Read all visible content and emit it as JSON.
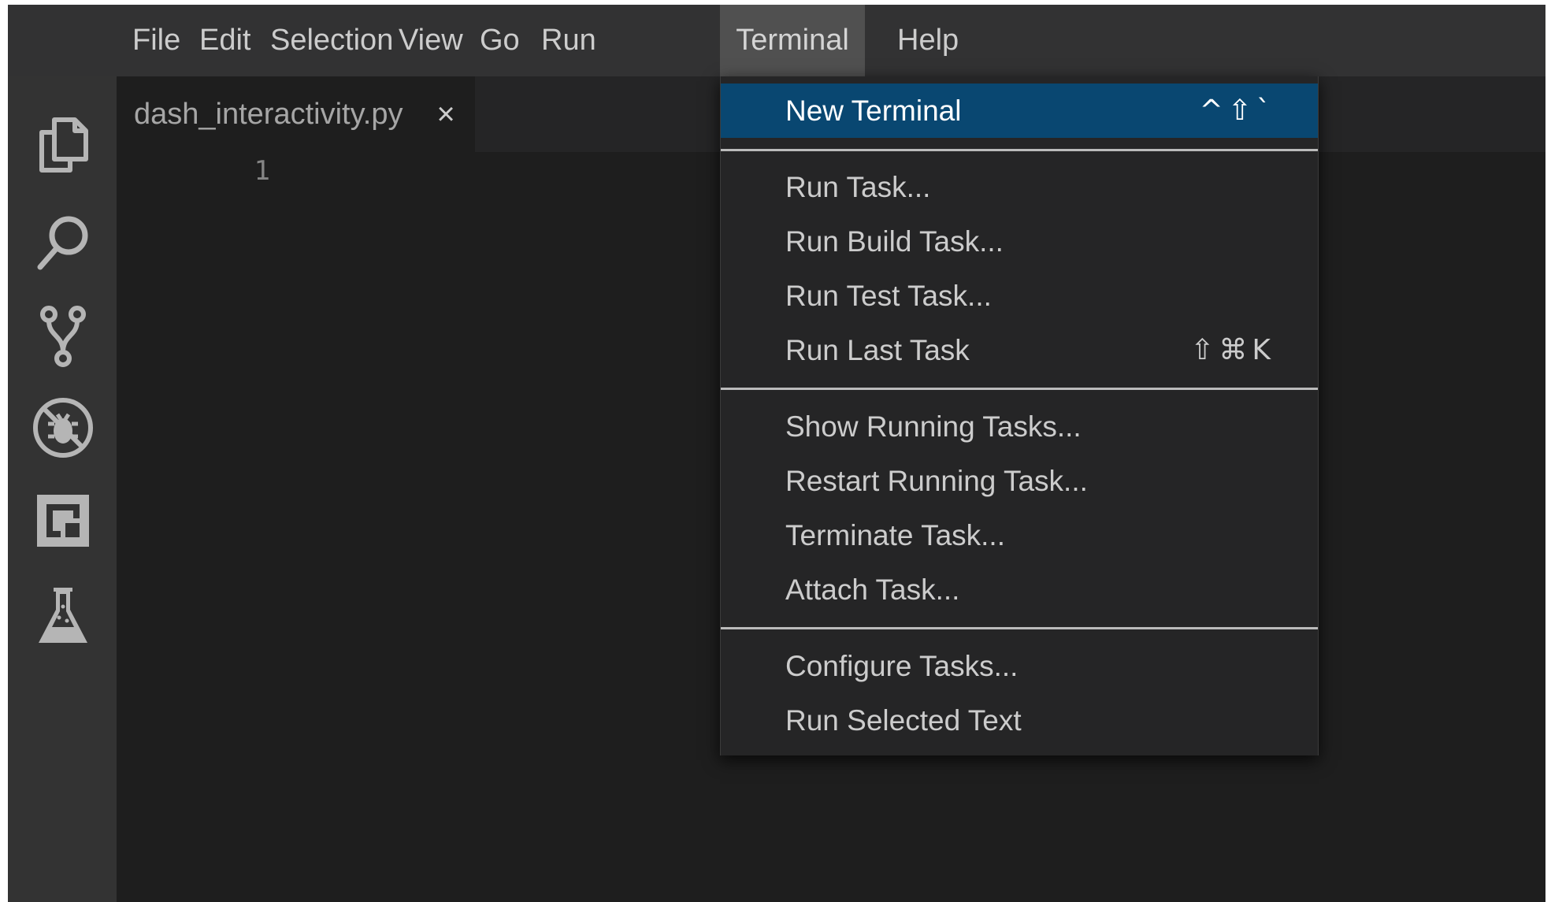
{
  "menubar": {
    "items": [
      {
        "label": "File"
      },
      {
        "label": "Edit"
      },
      {
        "label": "Selection"
      },
      {
        "label": "View"
      },
      {
        "label": "Go"
      },
      {
        "label": "Run"
      },
      {
        "label": "Terminal",
        "active": true
      },
      {
        "label": "Help"
      }
    ]
  },
  "activity_bar": {
    "icons": [
      "explorer-icon",
      "search-icon",
      "source-control-icon",
      "debug-icon",
      "extensions-icon",
      "testing-icon"
    ]
  },
  "editor": {
    "tab": {
      "label": "dash_interactivity.py",
      "close_glyph": "×"
    },
    "line_numbers": [
      "1"
    ]
  },
  "terminal_menu": {
    "groups": [
      [
        {
          "label": "New Terminal",
          "shortcut": "^⇧`",
          "selected": true
        }
      ],
      [
        {
          "label": "Run Task..."
        },
        {
          "label": "Run Build Task..."
        },
        {
          "label": "Run Test Task..."
        },
        {
          "label": "Run Last Task",
          "shortcut": "⇧⌘K"
        }
      ],
      [
        {
          "label": "Show Running Tasks..."
        },
        {
          "label": "Restart Running Task..."
        },
        {
          "label": "Terminate Task..."
        },
        {
          "label": "Attach Task..."
        }
      ],
      [
        {
          "label": "Configure Tasks..."
        },
        {
          "label": "Run Selected Text"
        }
      ]
    ]
  },
  "colors": {
    "menubar_bg": "#323233",
    "activity_bar_bg": "#333333",
    "editor_bg": "#1e1e1e",
    "menu_bg": "#252526",
    "menu_selected_bg": "#094771",
    "text": "#cccccc"
  }
}
